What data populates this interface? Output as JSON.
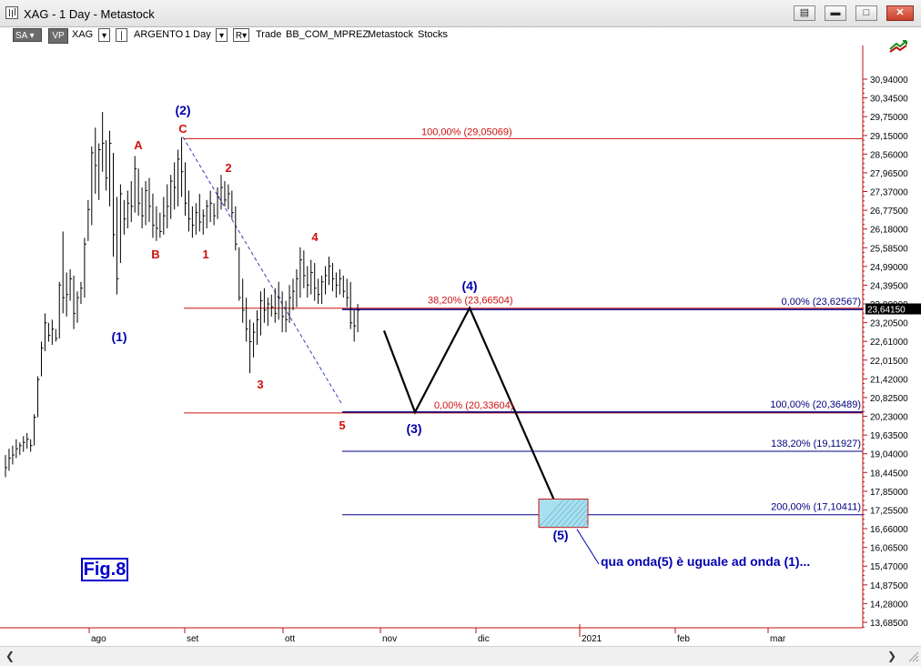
{
  "window": {
    "title": "XAG - 1 Day - Metastock",
    "buttons": [
      "restore-down",
      "minimize",
      "maximize",
      "close"
    ]
  },
  "toolbar": {
    "sa_label": "SA",
    "vp_label": "VP",
    "symbol": "XAG",
    "name": "ARGENTO",
    "period": "1 Day",
    "r_label": "R",
    "trade_label": "Trade",
    "list_label": "BB_COM_MPREZ",
    "provider_label": "Metastock",
    "type_label": "Stocks"
  },
  "colors": {
    "fib_red": "#d01010",
    "wave_blue": "#0000b0",
    "wave_red": "#d01010",
    "navy_line": "#000080",
    "bars": "#000000",
    "grid": "#e8e8e8",
    "target_box": "#a8e0f0"
  },
  "chart_data": {
    "type": "ohlc",
    "price_axis_labels": [
      "30,94000",
      "30,34500",
      "29,75000",
      "29,15000",
      "28,56000",
      "27,96500",
      "27,37000",
      "26,77500",
      "26,18000",
      "25,58500",
      "24,99000",
      "24,39500",
      "23,80000",
      "23,20500",
      "22,61000",
      "22,01500",
      "21,42000",
      "20,82500",
      "20,23000",
      "19,63500",
      "19,04000",
      "18,44500",
      "17,85000",
      "17,25500",
      "16,66000",
      "16,06500",
      "15,47000",
      "14,87500",
      "14,28000",
      "13,68500"
    ],
    "current_price_label": "23,64150",
    "current_price": 23.6415,
    "ylim": [
      13.4,
      31.5
    ],
    "time_axis_labels": [
      "ago",
      "set",
      "ott",
      "nov",
      "dic",
      "2021",
      "feb",
      "mar"
    ],
    "bars_series": [
      {
        "h": 19.0,
        "l": 18.3,
        "c": 18.6
      },
      {
        "h": 19.2,
        "l": 18.5,
        "c": 18.9
      },
      {
        "h": 19.3,
        "l": 18.7,
        "c": 19.0
      },
      {
        "h": 19.5,
        "l": 18.9,
        "c": 19.2
      },
      {
        "h": 19.4,
        "l": 19.0,
        "c": 19.3
      },
      {
        "h": 19.6,
        "l": 19.1,
        "c": 19.4
      },
      {
        "h": 19.7,
        "l": 19.2,
        "c": 19.5
      },
      {
        "h": 19.5,
        "l": 19.1,
        "c": 19.3
      },
      {
        "h": 20.3,
        "l": 19.3,
        "c": 20.2
      },
      {
        "h": 21.5,
        "l": 20.2,
        "c": 21.4
      },
      {
        "h": 22.6,
        "l": 21.5,
        "c": 22.4
      },
      {
        "h": 23.5,
        "l": 22.3,
        "c": 23.2
      },
      {
        "h": 23.2,
        "l": 22.6,
        "c": 22.8
      },
      {
        "h": 23.3,
        "l": 22.5,
        "c": 23.0
      },
      {
        "h": 23.0,
        "l": 22.6,
        "c": 22.7
      },
      {
        "h": 24.5,
        "l": 22.7,
        "c": 24.4
      },
      {
        "h": 26.1,
        "l": 23.5,
        "c": 24.0
      },
      {
        "h": 24.8,
        "l": 23.4,
        "c": 24.1
      },
      {
        "h": 24.9,
        "l": 23.9,
        "c": 24.6
      },
      {
        "h": 24.7,
        "l": 23.0,
        "c": 23.5
      },
      {
        "h": 24.2,
        "l": 23.2,
        "c": 24.0
      },
      {
        "h": 24.5,
        "l": 23.8,
        "c": 24.3
      },
      {
        "h": 25.9,
        "l": 24.0,
        "c": 25.7
      },
      {
        "h": 27.1,
        "l": 25.8,
        "c": 26.8
      },
      {
        "h": 28.8,
        "l": 26.3,
        "c": 28.6
      },
      {
        "h": 29.4,
        "l": 27.3,
        "c": 28.2
      },
      {
        "h": 28.9,
        "l": 27.1,
        "c": 28.7
      },
      {
        "h": 29.9,
        "l": 28.0,
        "c": 28.9
      },
      {
        "h": 29.0,
        "l": 27.4,
        "c": 27.8
      },
      {
        "h": 29.3,
        "l": 26.9,
        "c": 28.9
      },
      {
        "h": 28.6,
        "l": 25.3,
        "c": 26.0
      },
      {
        "h": 27.2,
        "l": 24.1,
        "c": 24.6
      },
      {
        "h": 27.6,
        "l": 25.1,
        "c": 27.3
      },
      {
        "h": 27.1,
        "l": 26.0,
        "c": 26.5
      },
      {
        "h": 27.4,
        "l": 26.2,
        "c": 27.0
      },
      {
        "h": 27.7,
        "l": 26.4,
        "c": 26.9
      },
      {
        "h": 28.5,
        "l": 26.7,
        "c": 28.1
      },
      {
        "h": 28.1,
        "l": 26.6,
        "c": 27.0
      },
      {
        "h": 27.5,
        "l": 26.2,
        "c": 26.6
      },
      {
        "h": 27.7,
        "l": 26.3,
        "c": 27.4
      },
      {
        "h": 27.8,
        "l": 26.4,
        "c": 26.9
      },
      {
        "h": 27.3,
        "l": 25.9,
        "c": 26.3
      },
      {
        "h": 26.9,
        "l": 25.8,
        "c": 26.2
      },
      {
        "h": 26.7,
        "l": 25.9,
        "c": 26.1
      },
      {
        "h": 27.2,
        "l": 26.0,
        "c": 26.6
      },
      {
        "h": 27.6,
        "l": 26.2,
        "c": 26.9
      },
      {
        "h": 27.9,
        "l": 26.5,
        "c": 27.7
      },
      {
        "h": 28.3,
        "l": 26.8,
        "c": 27.5
      },
      {
        "h": 28.7,
        "l": 26.9,
        "c": 28.4
      },
      {
        "h": 29.1,
        "l": 27.2,
        "c": 28.0
      },
      {
        "h": 28.3,
        "l": 26.6,
        "c": 27.0
      },
      {
        "h": 27.4,
        "l": 26.1,
        "c": 26.5
      },
      {
        "h": 26.9,
        "l": 25.9,
        "c": 26.3
      },
      {
        "h": 27.0,
        "l": 26.0,
        "c": 26.7
      },
      {
        "h": 27.3,
        "l": 26.1,
        "c": 26.4
      },
      {
        "h": 26.8,
        "l": 26.0,
        "c": 26.6
      },
      {
        "h": 27.1,
        "l": 26.2,
        "c": 26.9
      },
      {
        "h": 27.4,
        "l": 26.4,
        "c": 27.0
      },
      {
        "h": 27.0,
        "l": 26.3,
        "c": 26.6
      },
      {
        "h": 27.5,
        "l": 26.5,
        "c": 27.2
      },
      {
        "h": 27.9,
        "l": 26.8,
        "c": 27.5
      },
      {
        "h": 27.7,
        "l": 26.9,
        "c": 27.1
      },
      {
        "h": 27.6,
        "l": 26.8,
        "c": 27.3
      },
      {
        "h": 27.4,
        "l": 26.5,
        "c": 26.7
      },
      {
        "h": 26.9,
        "l": 25.5,
        "c": 25.7
      },
      {
        "h": 25.6,
        "l": 23.9,
        "c": 24.0
      },
      {
        "h": 24.6,
        "l": 23.2,
        "c": 23.6
      },
      {
        "h": 24.0,
        "l": 22.6,
        "c": 23.0
      },
      {
        "h": 23.3,
        "l": 21.6,
        "c": 22.6
      },
      {
        "h": 23.2,
        "l": 22.1,
        "c": 22.9
      },
      {
        "h": 23.6,
        "l": 22.5,
        "c": 23.3
      },
      {
        "h": 24.2,
        "l": 22.8,
        "c": 23.9
      },
      {
        "h": 24.3,
        "l": 23.2,
        "c": 23.6
      },
      {
        "h": 24.0,
        "l": 23.1,
        "c": 23.8
      },
      {
        "h": 24.1,
        "l": 23.4,
        "c": 23.7
      },
      {
        "h": 24.3,
        "l": 23.2,
        "c": 23.5
      },
      {
        "h": 24.5,
        "l": 23.3,
        "c": 24.0
      },
      {
        "h": 24.2,
        "l": 22.9,
        "c": 23.4
      },
      {
        "h": 23.9,
        "l": 22.9,
        "c": 23.3
      },
      {
        "h": 24.4,
        "l": 23.2,
        "c": 24.0
      },
      {
        "h": 24.6,
        "l": 23.6,
        "c": 24.2
      },
      {
        "h": 24.9,
        "l": 23.7,
        "c": 24.6
      },
      {
        "h": 25.6,
        "l": 24.0,
        "c": 25.2
      },
      {
        "h": 25.5,
        "l": 24.3,
        "c": 24.7
      },
      {
        "h": 25.0,
        "l": 24.0,
        "c": 24.4
      },
      {
        "h": 25.2,
        "l": 24.1,
        "c": 24.8
      },
      {
        "h": 25.1,
        "l": 23.9,
        "c": 24.3
      },
      {
        "h": 24.6,
        "l": 23.8,
        "c": 24.1
      },
      {
        "h": 24.7,
        "l": 23.8,
        "c": 24.5
      },
      {
        "h": 25.0,
        "l": 24.1,
        "c": 24.7
      },
      {
        "h": 25.3,
        "l": 24.4,
        "c": 25.0
      },
      {
        "h": 25.1,
        "l": 24.2,
        "c": 24.6
      },
      {
        "h": 24.8,
        "l": 24.0,
        "c": 24.4
      },
      {
        "h": 24.9,
        "l": 24.1,
        "c": 24.6
      },
      {
        "h": 24.7,
        "l": 24.0,
        "c": 24.2
      },
      {
        "h": 24.6,
        "l": 23.7,
        "c": 24.0
      },
      {
        "h": 24.5,
        "l": 23.0,
        "c": 23.2
      },
      {
        "h": 23.6,
        "l": 22.6,
        "c": 23.1
      },
      {
        "h": 23.8,
        "l": 22.9,
        "c": 23.6
      }
    ],
    "fib_levels": [
      {
        "label": "100,00% (29,05069)",
        "value": 29.05069,
        "color": "red"
      },
      {
        "label": "38,20% (23,66504)",
        "value": 23.66504,
        "color": "red"
      },
      {
        "label": "0,00% (20,33604)",
        "value": 20.33604,
        "color": "red"
      },
      {
        "label": "0,00% (23,62567)",
        "value": 23.62567,
        "color": "navy"
      },
      {
        "label": "100,00% (20,36489)",
        "value": 20.36489,
        "color": "navy"
      },
      {
        "label": "138,20% (19,11927)",
        "value": 19.11927,
        "color": "navy"
      },
      {
        "label": "200,00% (17,10411)",
        "value": 17.10411,
        "color": "navy"
      }
    ],
    "wave_labels_blue": [
      "(1)",
      "(2)",
      "(3)",
      "(4)",
      "(5)"
    ],
    "wave_labels_red": [
      "A",
      "B",
      "C",
      "1",
      "2",
      "3",
      "4",
      "5"
    ],
    "projection_path": [
      [
        22.95,
        24
      ],
      [
        20.36,
        55
      ],
      [
        23.67,
        85
      ],
      [
        17.1,
        149
      ]
    ],
    "target_zone": {
      "top": 17.6,
      "bottom": 16.7
    },
    "annotation": "qua onda(5) è uguale ad onda (1)...",
    "figure_label": "Fig.8"
  }
}
